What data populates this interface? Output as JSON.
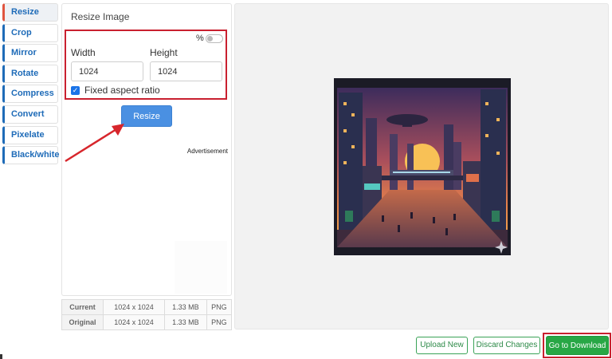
{
  "nav": {
    "items": [
      {
        "label": "Resize",
        "active": true
      },
      {
        "label": "Crop",
        "active": false
      },
      {
        "label": "Mirror",
        "active": false
      },
      {
        "label": "Rotate",
        "active": false
      },
      {
        "label": "Compress",
        "active": false
      },
      {
        "label": "Convert",
        "active": false
      },
      {
        "label": "Pixelate",
        "active": false
      },
      {
        "label": "Black/white",
        "active": false
      }
    ]
  },
  "panel": {
    "title": "Resize Image",
    "percent_label": "%",
    "percent_toggle_on": false,
    "width_label": "Width",
    "width_value": "1024",
    "height_label": "Height",
    "height_value": "1024",
    "fixed_aspect_label": "Fixed aspect ratio",
    "fixed_aspect_checked": true,
    "resize_button": "Resize",
    "ad_label": "Advertisement"
  },
  "info": {
    "rows": [
      {
        "label": "Current",
        "dims": "1024 x 1024",
        "size": "1.33 MB",
        "format": "PNG"
      },
      {
        "label": "Original",
        "dims": "1024 x 1024",
        "size": "1.33 MB",
        "format": "PNG"
      }
    ]
  },
  "footer": {
    "upload_new": "Upload New",
    "discard_changes": "Discard Changes",
    "go_to_download": "Go to Download"
  },
  "colors": {
    "accent_blue": "#1e6bb8",
    "button_blue": "#4a90e2",
    "download_green": "#28a745",
    "annotation_red": "#c9202f"
  }
}
